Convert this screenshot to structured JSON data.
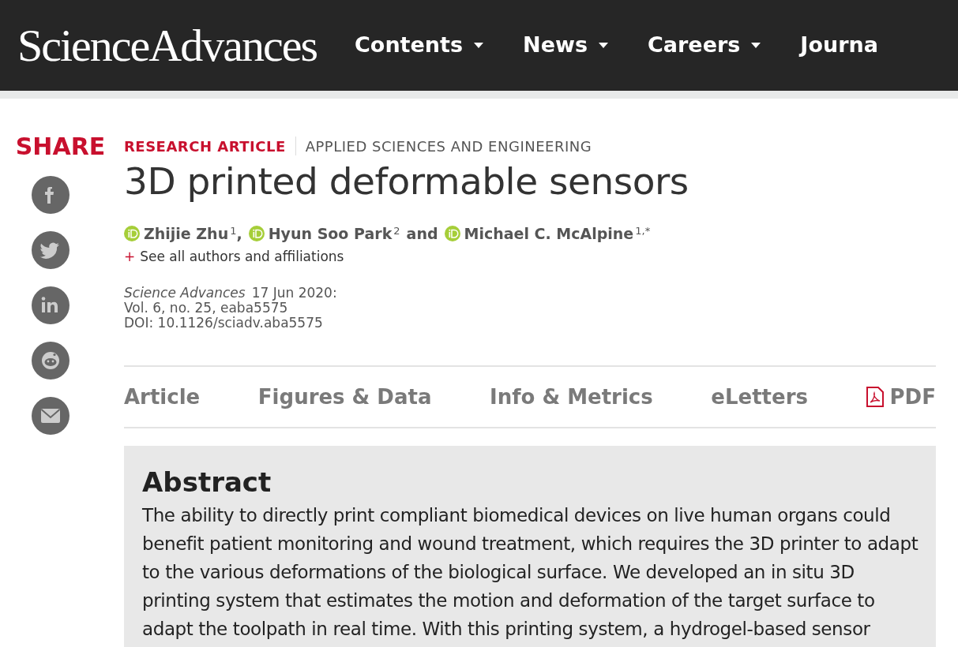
{
  "header": {
    "logo": "ScienceAdvances",
    "nav": [
      {
        "label": "Contents",
        "dropdown": true
      },
      {
        "label": "News",
        "dropdown": true
      },
      {
        "label": "Careers",
        "dropdown": true
      },
      {
        "label": "Journa",
        "dropdown": false
      }
    ]
  },
  "share": {
    "title": "SHARE",
    "buttons": [
      {
        "kind": "facebook"
      },
      {
        "kind": "twitter"
      },
      {
        "kind": "linkedin"
      },
      {
        "kind": "reddit"
      },
      {
        "kind": "email"
      }
    ]
  },
  "article": {
    "type": "RESEARCH ARTICLE",
    "section": "APPLIED SCIENCES AND ENGINEERING",
    "title": "3D printed deformable sensors",
    "authors": [
      {
        "name": "Zhijie Zhu",
        "affiliation": "1",
        "separator": ","
      },
      {
        "name": "Hyun Soo Park",
        "affiliation": "2",
        "separator": "and"
      },
      {
        "name": "Michael C. McAlpine",
        "affiliation": "1,*"
      }
    ],
    "expand": "+",
    "see_all": "See all authors and affiliations",
    "journal": "Science Advances",
    "date": "17 Jun 2020:",
    "volume": "Vol. 6, no. 25, eaba5575",
    "doi": "DOI: 10.1126/sciadv.aba5575"
  },
  "tabs": [
    {
      "label": "Article",
      "kind": "text"
    },
    {
      "label": "Figures & Data",
      "kind": "text"
    },
    {
      "label": "Info & Metrics",
      "kind": "text"
    },
    {
      "label": "eLetters",
      "kind": "text"
    },
    {
      "label": "PDF",
      "kind": "pdf"
    }
  ],
  "abstract": {
    "heading": "Abstract",
    "text": "The ability to directly print compliant biomedical devices on live human organs could benefit patient monitoring and wound treatment, which requires the 3D printer to adapt to the various deformations of the biological surface. We developed an in situ 3D printing system that estimates the motion and deformation of the target surface to adapt the toolpath in real time. With this printing system, a hydrogel-based sensor"
  }
}
